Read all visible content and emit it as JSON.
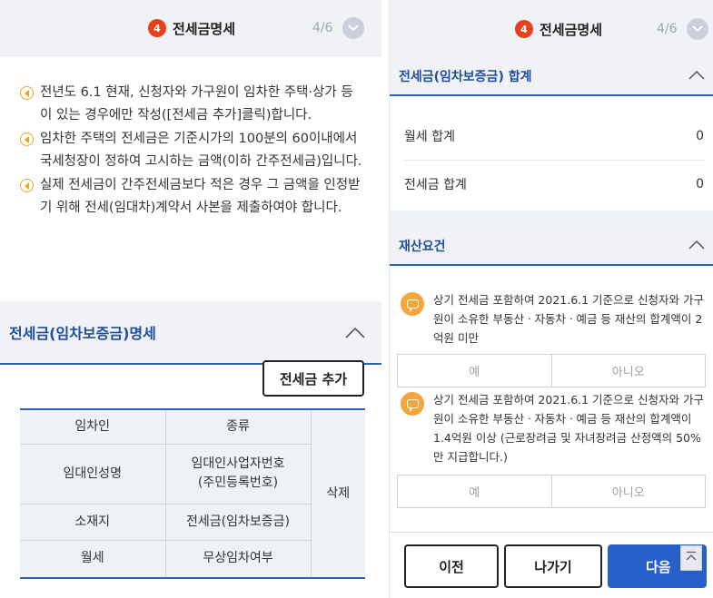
{
  "left": {
    "header": {
      "step_number": "4",
      "title": "전세금명세",
      "progress": "4/6"
    },
    "notes": [
      "전년도 6.1 현재, 신청자와 가구원이 임차한 주택·상가 등이 있는 경우에만 작성([전세금 추가]클릭)합니다.",
      "임차한 주택의 전세금은 기준시가의 100분의 60이내에서 국세청장이 정하여 고시하는 금액(이하 간주전세금)입니다.",
      "실제 전세금이 간주전세금보다 적은 경우 그 금액을 인정받기 위해 전세(임대차)계약서 사본을 제출하여야 합니다."
    ],
    "section_title": "전세금(임차보증금)명세",
    "add_button": "전세금 추가",
    "table": {
      "r1c1": "임차인",
      "r1c2": "종류",
      "r2c1": "임대인성명",
      "r2c2a": "임대인사업자번호",
      "r2c2b": "(주민등록번호)",
      "r3c1": "소재지",
      "r3c2": "전세금(임차보증금)",
      "r4c1": "월세",
      "r4c2": "무상임차여부",
      "delete": "삭제"
    }
  },
  "right": {
    "header": {
      "step_number": "4",
      "title": "전세금명세",
      "progress": "4/6"
    },
    "sum_section": {
      "title": "전세금(임차보증금) 합계",
      "rows": [
        {
          "label": "월세 합계",
          "value": "0"
        },
        {
          "label": "전세금 합계",
          "value": "0"
        }
      ]
    },
    "asset_section": {
      "title": "재산요건",
      "questions": [
        {
          "text": "상기 전세금 포함하여 2021.6.1 기준으로 신청자와 가구원이 소유한 부동산ㆍ자동차ㆍ예금 등 재산의 합계액이 2억원 미만",
          "yes": "예",
          "no": "아니오"
        },
        {
          "text": "상기 전세금 포함하여 2021.6.1 기준으로 신청자와 가구원이 소유한 부동산ㆍ자동차ㆍ예금 등 재산의 합계액이 1.4억원 이상 (근로장려금 및 자녀장려금 산정액의 50%만 지급합니다.)",
          "yes": "예",
          "no": "아니오"
        }
      ]
    },
    "footer": {
      "prev": "이전",
      "exit": "나가기",
      "next": "다음"
    }
  },
  "colors": {
    "accent_blue": "#2e63b5",
    "step_badge": "#e8401c",
    "bullet": "#f0a21a",
    "next_button": "#2760c8"
  }
}
